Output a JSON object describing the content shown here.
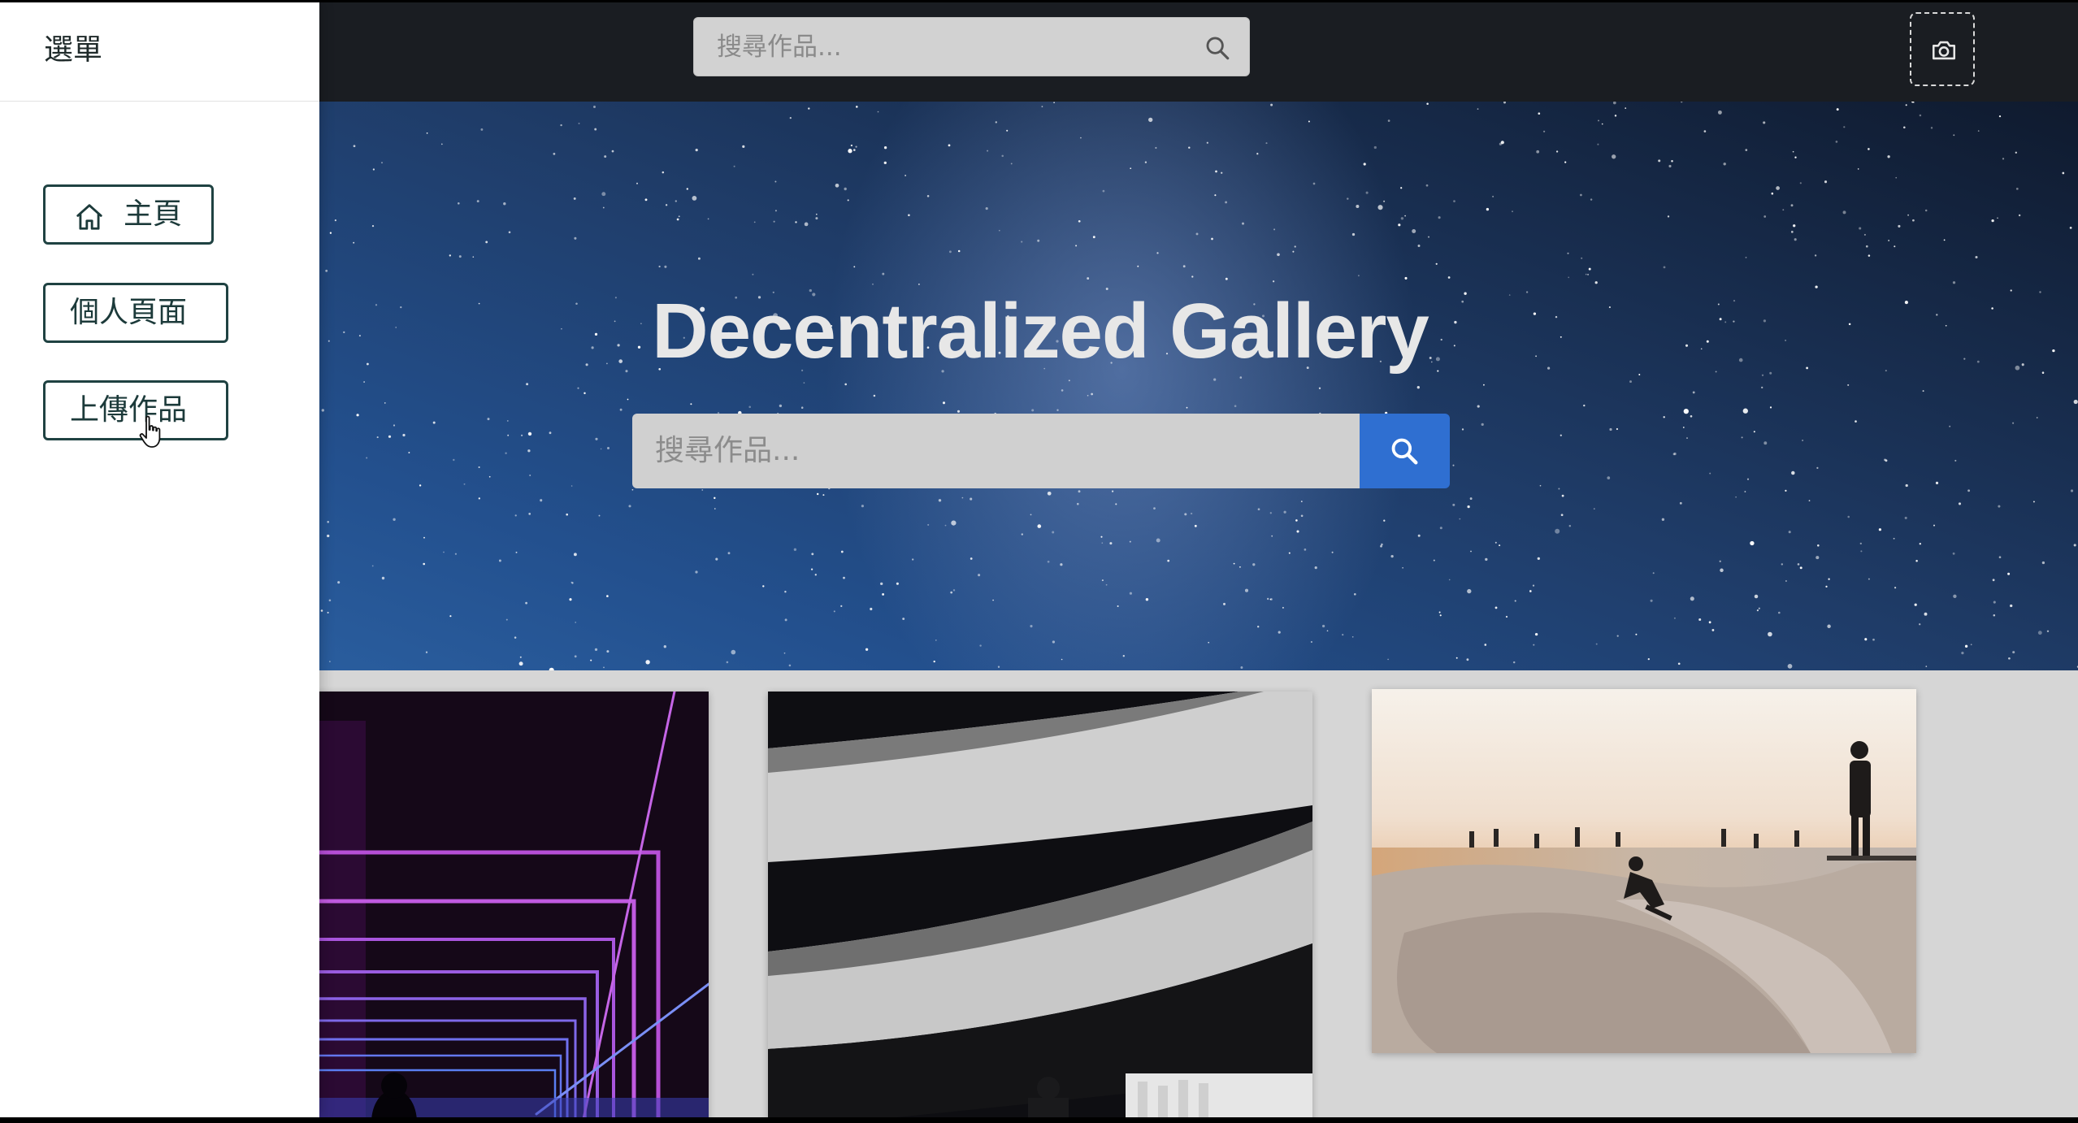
{
  "sidebar": {
    "title": "選單",
    "items": [
      {
        "label": "主頁",
        "icon": "home-icon"
      },
      {
        "label": "個人頁面"
      },
      {
        "label": "上傳作品"
      }
    ]
  },
  "topbar": {
    "search_placeholder": "搜尋作品...",
    "search_icon": "search-icon",
    "camera_icon": "camera-icon"
  },
  "hero": {
    "title": "Decentralized Gallery",
    "search_placeholder": "搜尋作品...",
    "search_icon": "search-icon"
  },
  "gallery": {
    "cards": [
      {
        "subject": "neon-corridor"
      },
      {
        "subject": "spiral-parking-ramp"
      },
      {
        "subject": "skatepark-sunset"
      }
    ]
  },
  "colors": {
    "topbar": "#1a1d22",
    "accent": "#2f6fd1",
    "sidebar_button_border": "#1f4242"
  }
}
